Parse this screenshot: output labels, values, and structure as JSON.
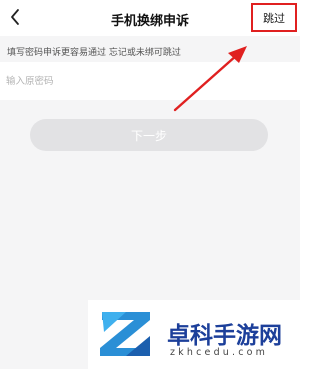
{
  "header": {
    "back_icon": "chevron-left-icon",
    "title": "手机换绑申诉",
    "skip_label": "跳过",
    "skip_highlight_color": "#e02020"
  },
  "form": {
    "hint": "填写密码申诉更容易通过 忘记或未绑可跳过",
    "password_value": "",
    "password_placeholder": "输入原密码",
    "next_label": "下一步"
  },
  "annotation": {
    "arrow_icon": "red-arrow-icon",
    "color": "#e02020"
  },
  "watermark": {
    "logo_icon": "z-logo-icon",
    "name": "卓科手游网",
    "url": "zkhcedu.com"
  }
}
